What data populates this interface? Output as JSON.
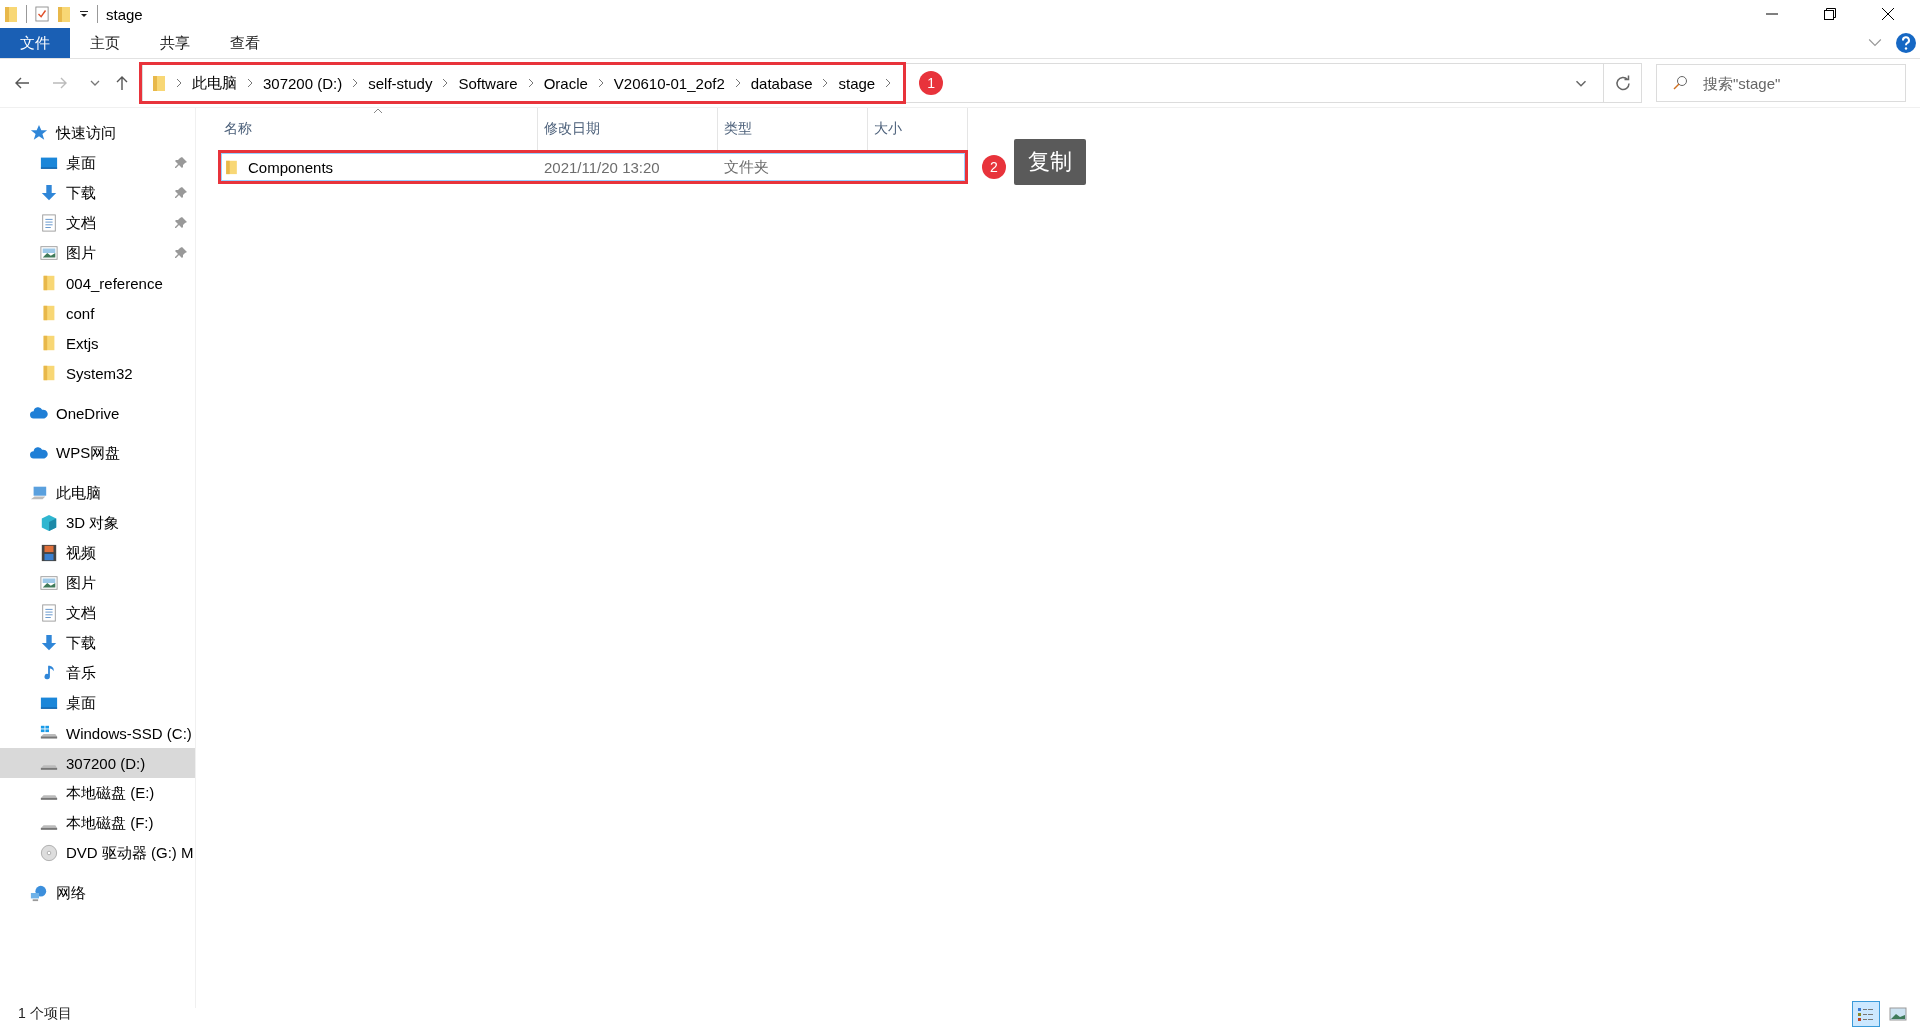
{
  "window": {
    "title": "stage"
  },
  "ribbon_tabs": [
    {
      "label": "文件",
      "kind": "file"
    },
    {
      "label": "主页",
      "kind": "tab"
    },
    {
      "label": "共享",
      "kind": "tab"
    },
    {
      "label": "查看",
      "kind": "tab"
    }
  ],
  "address_bar": {
    "segments": [
      "此电脑",
      "307200 (D:)",
      "self-study",
      "Software",
      "Oracle",
      "V20610-01_2of2",
      "database",
      "stage"
    ],
    "annotation": "1"
  },
  "search": {
    "placeholder": "搜索\"stage\""
  },
  "sidebar": {
    "items": [
      {
        "label": "快速访问",
        "kind": "star",
        "selected": false,
        "children": [
          {
            "label": "桌面",
            "kind": "desktop",
            "pinned": true,
            "selected": false
          },
          {
            "label": "下载",
            "kind": "download",
            "pinned": true,
            "selected": false
          },
          {
            "label": "文档",
            "kind": "document",
            "pinned": true,
            "selected": false
          },
          {
            "label": "图片",
            "kind": "picture",
            "pinned": true,
            "selected": false
          },
          {
            "label": "004_reference",
            "kind": "folder",
            "pinned": false,
            "selected": false
          },
          {
            "label": "conf",
            "kind": "folder",
            "pinned": false,
            "selected": false
          },
          {
            "label": "Extjs",
            "kind": "folder",
            "pinned": false,
            "selected": false
          },
          {
            "label": "System32",
            "kind": "folder",
            "pinned": false,
            "selected": false
          }
        ]
      },
      {
        "label": "OneDrive",
        "kind": "cloud",
        "selected": false
      },
      {
        "label": "WPS网盘",
        "kind": "cloud",
        "selected": false
      },
      {
        "label": "此电脑",
        "kind": "computer",
        "selected": false,
        "children": [
          {
            "label": "3D 对象",
            "kind": "cube",
            "pinned": false,
            "selected": false
          },
          {
            "label": "视频",
            "kind": "video",
            "pinned": false,
            "selected": false
          },
          {
            "label": "图片",
            "kind": "picture",
            "pinned": false,
            "selected": false
          },
          {
            "label": "文档",
            "kind": "document",
            "pinned": false,
            "selected": false
          },
          {
            "label": "下载",
            "kind": "download",
            "pinned": false,
            "selected": false
          },
          {
            "label": "音乐",
            "kind": "music",
            "pinned": false,
            "selected": false
          },
          {
            "label": "桌面",
            "kind": "desktop",
            "pinned": false,
            "selected": false
          },
          {
            "label": "Windows-SSD (C:)",
            "kind": "windows-drive",
            "pinned": false,
            "selected": false
          },
          {
            "label": "307200 (D:)",
            "kind": "drive",
            "pinned": false,
            "selected": true
          },
          {
            "label": "本地磁盘 (E:)",
            "kind": "drive",
            "pinned": false,
            "selected": false
          },
          {
            "label": "本地磁盘 (F:)",
            "kind": "drive",
            "pinned": false,
            "selected": false
          },
          {
            "label": "DVD 驱动器 (G:) M",
            "kind": "dvd",
            "pinned": false,
            "selected": false
          }
        ]
      },
      {
        "label": "网络",
        "kind": "network",
        "selected": false
      }
    ]
  },
  "table": {
    "columns": [
      {
        "label": "名称",
        "sorted": true
      },
      {
        "label": "修改日期",
        "sorted": false
      },
      {
        "label": "类型",
        "sorted": false
      },
      {
        "label": "大小",
        "sorted": false
      }
    ],
    "rows": [
      {
        "name": "Components",
        "modified": "2021/11/20 13:20",
        "type": "文件夹",
        "focused": true,
        "annotation": "2",
        "callout": "复制"
      }
    ]
  },
  "status_bar": {
    "text": "1 个项目",
    "views": [
      {
        "kind": "details",
        "selected": true
      },
      {
        "kind": "large-icons",
        "selected": false
      }
    ]
  }
}
